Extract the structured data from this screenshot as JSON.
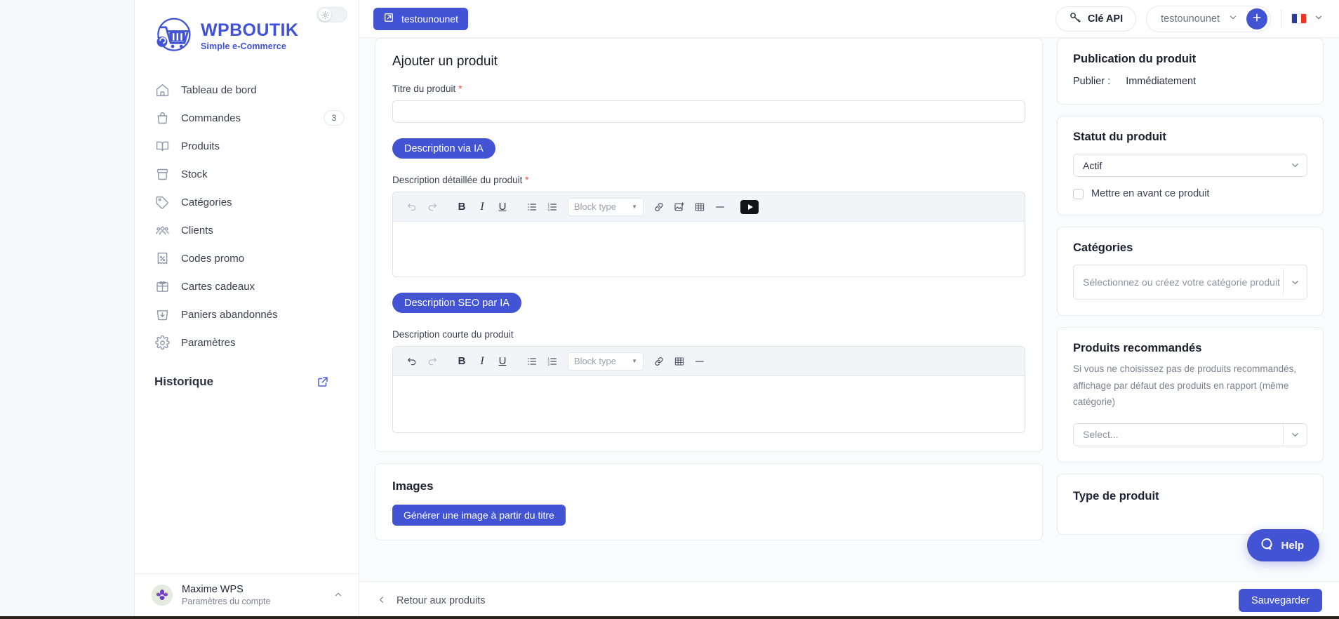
{
  "brand": {
    "name": "WPBOUTIK",
    "tagline": "Simple e-Commerce",
    "logo_icon": "shopping-cart-icon",
    "accent": "#4254d4"
  },
  "sidebar": {
    "theme_toggle_icon": "sun-icon",
    "items": [
      {
        "label": "Tableau de bord",
        "icon": "home-icon",
        "badge": null
      },
      {
        "label": "Commandes",
        "icon": "bag-icon",
        "badge": "3"
      },
      {
        "label": "Produits",
        "icon": "book-icon",
        "badge": null
      },
      {
        "label": "Stock",
        "icon": "box-icon",
        "badge": null
      },
      {
        "label": "Catégories",
        "icon": "tag-icon",
        "badge": null
      },
      {
        "label": "Clients",
        "icon": "users-icon",
        "badge": null
      },
      {
        "label": "Codes promo",
        "icon": "percent-receipt-icon",
        "badge": null
      },
      {
        "label": "Cartes cadeaux",
        "icon": "gift-icon",
        "badge": null
      },
      {
        "label": "Paniers abandonnés",
        "icon": "abandoned-cart-icon",
        "badge": null
      },
      {
        "label": "Paramètres",
        "icon": "gear-icon",
        "badge": null
      }
    ],
    "history": {
      "title": "Historique",
      "external_icon": "external-link-icon"
    },
    "user": {
      "name": "Maxime WPS",
      "subtitle": "Paramètres du compte",
      "avatar_icon": "avatar-icon",
      "caret_icon": "chevron-up-icon"
    }
  },
  "topbar": {
    "shop_button": {
      "label": "testounounet",
      "icon": "external-link-icon"
    },
    "api_key": {
      "label": "Clé API",
      "icon": "key-icon"
    },
    "shop_select": {
      "value": "testounounet",
      "chevron_icon": "chevron-down-icon"
    },
    "add_button": {
      "label": "+",
      "icon": "plus-icon"
    },
    "language": {
      "flag": "fr-flag-icon",
      "chevron_icon": "chevron-down-icon"
    }
  },
  "main": {
    "page_title": "Ajouter un produit",
    "title_field": {
      "label": "Titre du produit",
      "required": true,
      "value": "",
      "placeholder": ""
    },
    "ai_description_button": "Description via IA",
    "detailed_description": {
      "label": "Description détaillée du produit",
      "required": true,
      "content": ""
    },
    "seo_description_button": "Description SEO par IA",
    "short_description": {
      "label": "Description courte du produit",
      "required": false,
      "content": ""
    },
    "editor_toolbar": {
      "undo": "undo-icon",
      "redo": "redo-icon",
      "bold": "B",
      "italic": "I",
      "underline": "U",
      "bullet_list": "bullet-list-icon",
      "numbered_list": "numbered-list-icon",
      "block_type_placeholder": "Block type",
      "link": "link-icon",
      "image": "image-icon",
      "table": "table-icon",
      "divider": "horizontal-rule-icon",
      "video": "youtube-icon"
    },
    "images_section": {
      "title": "Images",
      "generate_button": "Générer une image à partir du titre"
    }
  },
  "right_panels": {
    "publication": {
      "title": "Publication du produit",
      "publish_label": "Publier :",
      "publish_value": "Immédiatement"
    },
    "status": {
      "title": "Statut du produit",
      "value": "Actif",
      "featured_label": "Mettre en avant ce produit",
      "featured_checked": false
    },
    "categories": {
      "title": "Catégories",
      "placeholder": "Sélectionnez ou créez votre catégorie produit"
    },
    "recommended": {
      "title": "Produits recommandés",
      "help": "Si vous ne choisissez pas de produits recommandés, affichage par défaut des produits en rapport (même catégorie)",
      "placeholder": "Select..."
    },
    "product_type": {
      "title": "Type de produit"
    }
  },
  "bottombar": {
    "back_label": "Retour aux produits",
    "back_icon": "chevron-left-icon",
    "save_label": "Sauvegarder"
  },
  "help_widget": {
    "label": "Help",
    "icon": "chat-bubble-icon"
  }
}
